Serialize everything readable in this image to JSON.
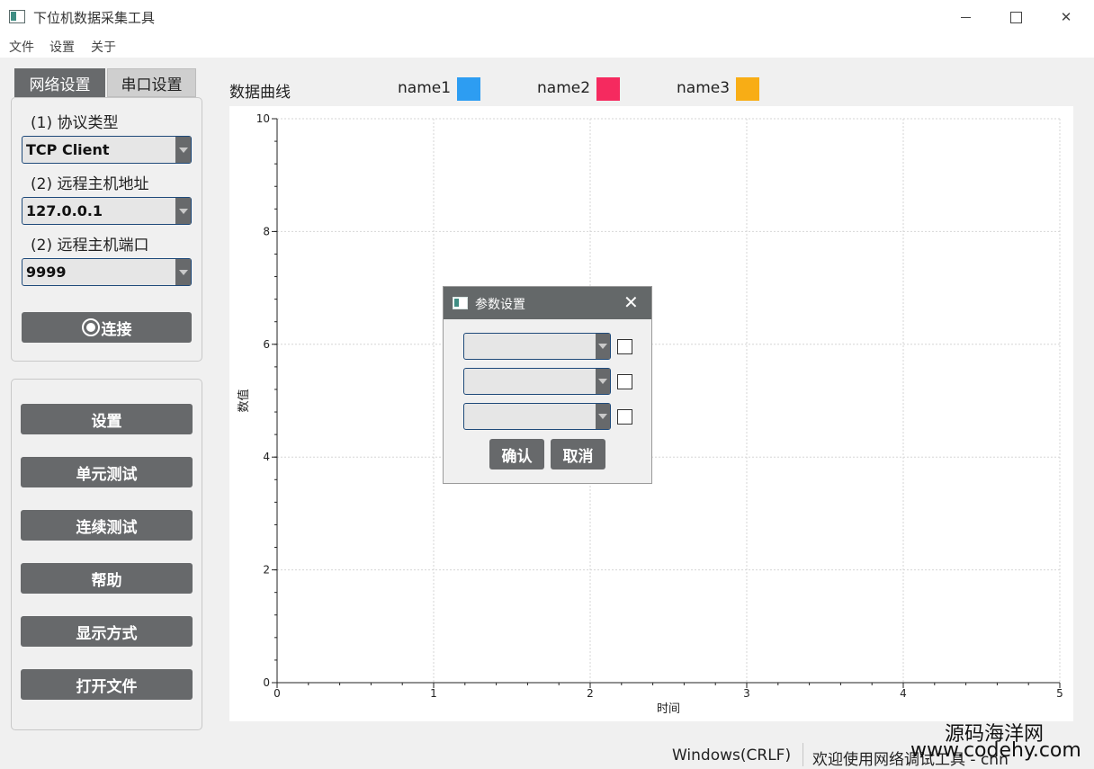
{
  "window": {
    "title": "下位机数据采集工具",
    "minimize_label": "",
    "close_label": "✕"
  },
  "menu": [
    "文件",
    "设置",
    "关于"
  ],
  "tabs": [
    "网络设置",
    "串口设置"
  ],
  "network": {
    "protocol_label": "(1) 协议类型",
    "protocol_value": "TCP Client",
    "host_label": "(2) 远程主机地址",
    "host_value": "127.0.0.1",
    "port_label": "(2) 远程主机端口",
    "port_value": "9999",
    "connect_label": "连接"
  },
  "actions": [
    "设置",
    "单元测试",
    "连续测试",
    "帮助",
    "显示方式",
    "打开文件"
  ],
  "chart_header": {
    "title": "数据曲线",
    "legend": [
      {
        "name": "name1",
        "color": "#2d9df2"
      },
      {
        "name": "name2",
        "color": "#f52a5f"
      },
      {
        "name": "name3",
        "color": "#f8ad15"
      }
    ]
  },
  "chart_data": {
    "type": "line",
    "title": "",
    "xlabel": "时间",
    "ylabel": "数值",
    "xlim": [
      0,
      5
    ],
    "ylim": [
      0,
      10
    ],
    "xticks": [
      0,
      1,
      2,
      3,
      4,
      5
    ],
    "yticks": [
      0,
      2,
      4,
      6,
      8,
      10
    ],
    "grid": true,
    "series": [
      {
        "name": "name1",
        "color": "#2d9df2",
        "values": []
      },
      {
        "name": "name2",
        "color": "#f52a5f",
        "values": []
      },
      {
        "name": "name3",
        "color": "#f8ad15",
        "values": []
      }
    ]
  },
  "dialog": {
    "title": "参数设置",
    "close_label": "✕",
    "rows": [
      {
        "value": "",
        "checked": false
      },
      {
        "value": "",
        "checked": false
      },
      {
        "value": "",
        "checked": false
      }
    ],
    "ok_label": "确认",
    "cancel_label": "取消"
  },
  "status": {
    "line_ending": "Windows(CRLF)",
    "message": "欢迎使用网络调试工具 - cnn"
  },
  "watermark": {
    "line1": "源码海洋网",
    "line2": "www.codehy.com"
  }
}
